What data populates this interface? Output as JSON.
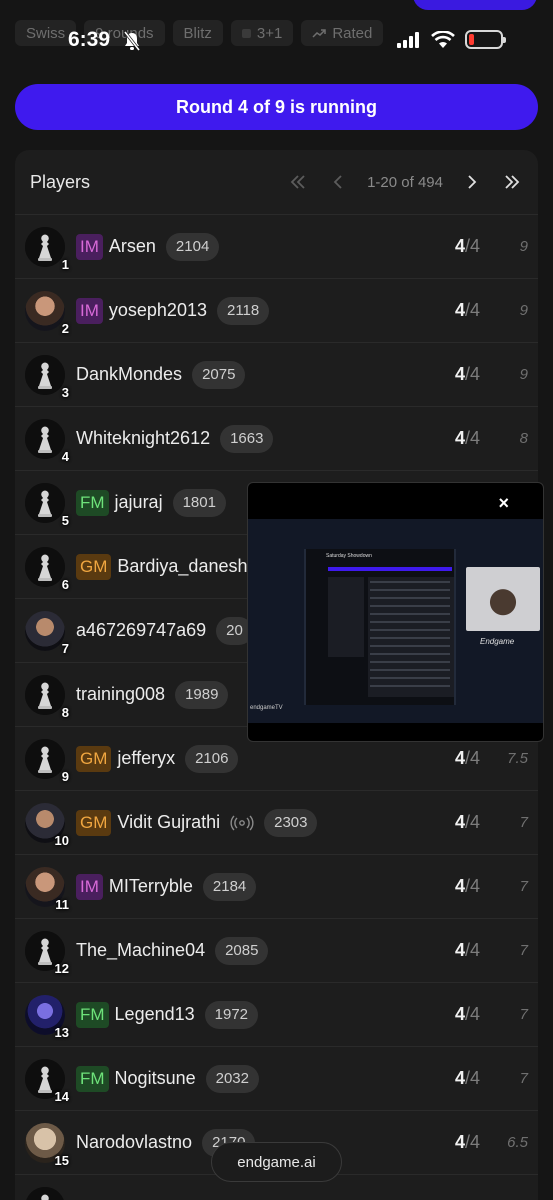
{
  "status_bar": {
    "time": "6:39"
  },
  "tags": [
    {
      "label": "Swiss"
    },
    {
      "label": "9 rounds"
    },
    {
      "label": "Blitz"
    },
    {
      "label": "3+1"
    },
    {
      "label": "Rated"
    }
  ],
  "round_banner": "Round 4 of 9 is running",
  "players_panel": {
    "title": "Players",
    "range": "1-20 of 494",
    "rows": [
      {
        "rank": "1",
        "title": "IM",
        "name": "Arsen",
        "rating": "2104",
        "score": "4",
        "games": "/4",
        "tiebreak": "9"
      },
      {
        "rank": "2",
        "title": "IM",
        "name": "yoseph2013",
        "rating": "2118",
        "score": "4",
        "games": "/4",
        "tiebreak": "9"
      },
      {
        "rank": "3",
        "title": "",
        "name": "DankMondes",
        "rating": "2075",
        "score": "4",
        "games": "/4",
        "tiebreak": "9"
      },
      {
        "rank": "4",
        "title": "",
        "name": "Whiteknight2612",
        "rating": "1663",
        "score": "4",
        "games": "/4",
        "tiebreak": "8"
      },
      {
        "rank": "5",
        "title": "FM",
        "name": "jajuraj",
        "rating": "1801",
        "score": "",
        "games": "",
        "tiebreak": ""
      },
      {
        "rank": "6",
        "title": "GM",
        "name": "Bardiya_danesh",
        "rating": "",
        "score": "",
        "games": "",
        "tiebreak": ""
      },
      {
        "rank": "7",
        "title": "",
        "name": "a467269747a69",
        "rating": "20",
        "score": "",
        "games": "",
        "tiebreak": ""
      },
      {
        "rank": "8",
        "title": "",
        "name": "training008",
        "rating": "1989",
        "score": "",
        "games": "",
        "tiebreak": ""
      },
      {
        "rank": "9",
        "title": "GM",
        "name": "jefferyx",
        "rating": "2106",
        "score": "4",
        "games": "/4",
        "tiebreak": "7.5"
      },
      {
        "rank": "10",
        "title": "GM",
        "name": "Vidit Gujrathi",
        "rating": "2303",
        "score": "4",
        "games": "/4",
        "tiebreak": "7"
      },
      {
        "rank": "11",
        "title": "IM",
        "name": "MITerryble",
        "rating": "2184",
        "score": "4",
        "games": "/4",
        "tiebreak": "7"
      },
      {
        "rank": "12",
        "title": "",
        "name": "The_Machine04",
        "rating": "2085",
        "score": "4",
        "games": "/4",
        "tiebreak": "7"
      },
      {
        "rank": "13",
        "title": "FM",
        "name": "Legend13",
        "rating": "1972",
        "score": "4",
        "games": "/4",
        "tiebreak": "7"
      },
      {
        "rank": "14",
        "title": "FM",
        "name": "Nogitsune",
        "rating": "2032",
        "score": "4",
        "games": "/4",
        "tiebreak": "7"
      },
      {
        "rank": "15",
        "title": "",
        "name": "Narodovlastno",
        "rating": "2170",
        "score": "4",
        "games": "/4",
        "tiebreak": "6.5"
      }
    ]
  },
  "pip": {
    "close": "×",
    "screen_title": "Saturday Showdown",
    "cam_label": "Endgame",
    "logo": "endgameTV"
  },
  "floating_pill": "endgame.ai",
  "colors": {
    "accent": "#3f1aee",
    "im": "#d86ad8",
    "fm": "#6ee27a",
    "gm": "#f0a640"
  }
}
